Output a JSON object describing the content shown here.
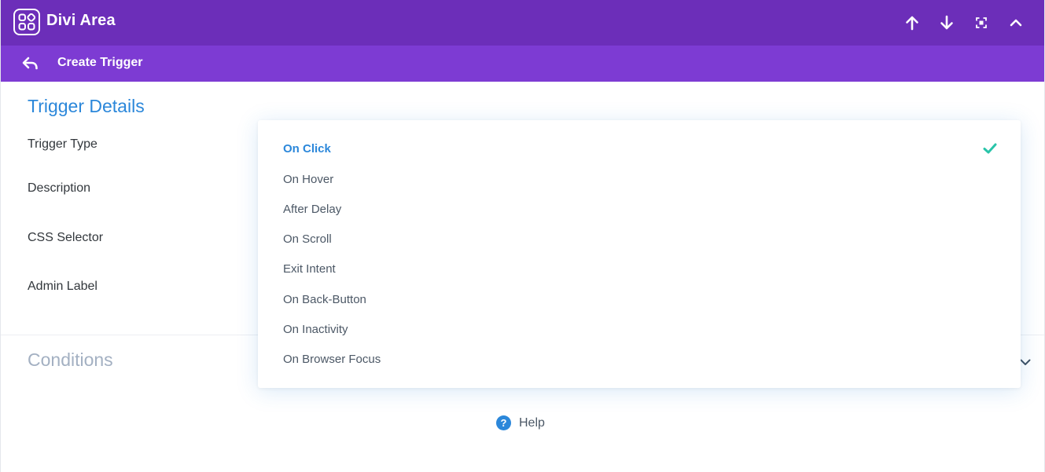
{
  "header": {
    "title": "Divi Area",
    "actions": [
      {
        "name": "move-up-button",
        "icon": "arrow-up-icon"
      },
      {
        "name": "move-down-button",
        "icon": "arrow-down-icon"
      },
      {
        "name": "expand-button",
        "icon": "expand-icon"
      },
      {
        "name": "collapse-button",
        "icon": "chevron-up-icon"
      }
    ]
  },
  "subheader": {
    "title": "Create Trigger",
    "back_icon": "back-arrow-icon"
  },
  "trigger_details": {
    "title": "Trigger Details",
    "fields": {
      "trigger_type": "Trigger Type",
      "description": "Description",
      "css_selector": "CSS Selector",
      "admin_label": "Admin Label"
    }
  },
  "dropdown": {
    "selected": "On Click",
    "options": [
      "On Click",
      "On Hover",
      "After Delay",
      "On Scroll",
      "Exit Intent",
      "On Back-Button",
      "On Inactivity",
      "On Browser Focus"
    ]
  },
  "conditions": {
    "title": "Conditions"
  },
  "help": {
    "label": "Help",
    "icon_glyph": "?"
  },
  "colors": {
    "header_bg": "#6c2eb9",
    "subheader_bg": "#7d3bd3",
    "accent_blue": "#2b87da",
    "check_green": "#29c4a9",
    "muted_title": "#a3b0c2"
  }
}
